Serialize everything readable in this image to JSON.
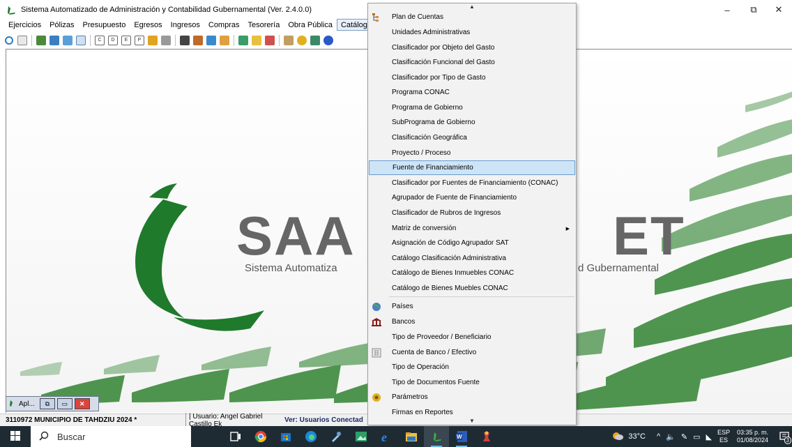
{
  "window": {
    "title": "Sistema Automatizado de Administración y Contabilidad Gubernamental  (Ver. 2.4.0.0)",
    "minimize_label": "–",
    "restore_label": "⧉",
    "close_label": "✕"
  },
  "menubar": {
    "items": [
      "Ejercicios",
      "Pólizas",
      "Presupuesto",
      "Egresos",
      "Ingresos",
      "Compras",
      "Tesorería",
      "Obra Pública",
      "Catálogos"
    ]
  },
  "logo": {
    "text_left": "SAA",
    "text_right": "ET",
    "subtitle_left": "Sistema Automatiza",
    "subtitle_right": "d Gubernamental"
  },
  "minimized_window": {
    "label": "Apl..."
  },
  "statusbar": {
    "org": "3110972 MUNICIPIO DE TAHDZIU  2024  *",
    "user": "| Usuario: Angel Gabriel Castillo Ek",
    "link": "Ver: Usuarios Conectad"
  },
  "catalogos_menu": {
    "items": [
      {
        "label": "Plan de Cuentas",
        "icon": "tree-icon"
      },
      {
        "label": "Unidades Administrativas",
        "icon": ""
      },
      {
        "label": "Clasificador por Objeto del Gasto",
        "icon": ""
      },
      {
        "label": "Clasificación Funcional del Gasto",
        "icon": ""
      },
      {
        "label": "Clasificador por Tipo de Gasto",
        "icon": ""
      },
      {
        "label": "Programa CONAC",
        "icon": ""
      },
      {
        "label": "Programa de Gobierno",
        "icon": ""
      },
      {
        "label": "SubPrograma de Gobierno",
        "icon": ""
      },
      {
        "label": "Clasificación Geográfica",
        "icon": ""
      },
      {
        "label": "Proyecto / Proceso",
        "icon": ""
      },
      {
        "label": "Fuente de Financiamiento",
        "icon": "",
        "highlighted": true
      },
      {
        "label": "Clasificador por Fuentes de Financiamiento (CONAC)",
        "icon": ""
      },
      {
        "label": "Agrupador de Fuente de Financiamiento",
        "icon": ""
      },
      {
        "label": "Clasificador de Rubros de Ingresos",
        "icon": ""
      },
      {
        "label": "Matriz de conversión",
        "icon": "",
        "submenu": true
      },
      {
        "label": "Asignación de Código Agrupador SAT",
        "icon": ""
      },
      {
        "label": "Catálogo Clasificación Administrativa",
        "icon": ""
      },
      {
        "label": "Catálogo de Bienes Inmuebles CONAC",
        "icon": ""
      },
      {
        "label": "Catálogo de Bienes Muebles CONAC",
        "icon": ""
      },
      {
        "label": "Países",
        "icon": "globe-icon"
      },
      {
        "label": "Bancos",
        "icon": "bank-icon"
      },
      {
        "label": "Tipo de Proveedor / Beneficiario",
        "icon": ""
      },
      {
        "label": "Cuenta de Banco / Efectivo",
        "icon": "calculator-icon"
      },
      {
        "label": "Tipo de Operación",
        "icon": ""
      },
      {
        "label": "Tipo de Documentos Fuente",
        "icon": ""
      },
      {
        "label": "Parámetros",
        "icon": "settings-icon"
      },
      {
        "label": "Firmas en Reportes",
        "icon": ""
      }
    ]
  },
  "taskbar": {
    "search_placeholder": "Buscar",
    "weather": "33°C",
    "language": "ESP",
    "language_sub": "ES",
    "time": "03:35 p. m.",
    "date": "01/08/2024",
    "notification_count": "3"
  },
  "colors": {
    "logo_green": "#1f7a2c",
    "logo_gray": "#6a6a6a",
    "menu_highlight": "#cde4f7",
    "taskbar": "#1f2b33"
  }
}
